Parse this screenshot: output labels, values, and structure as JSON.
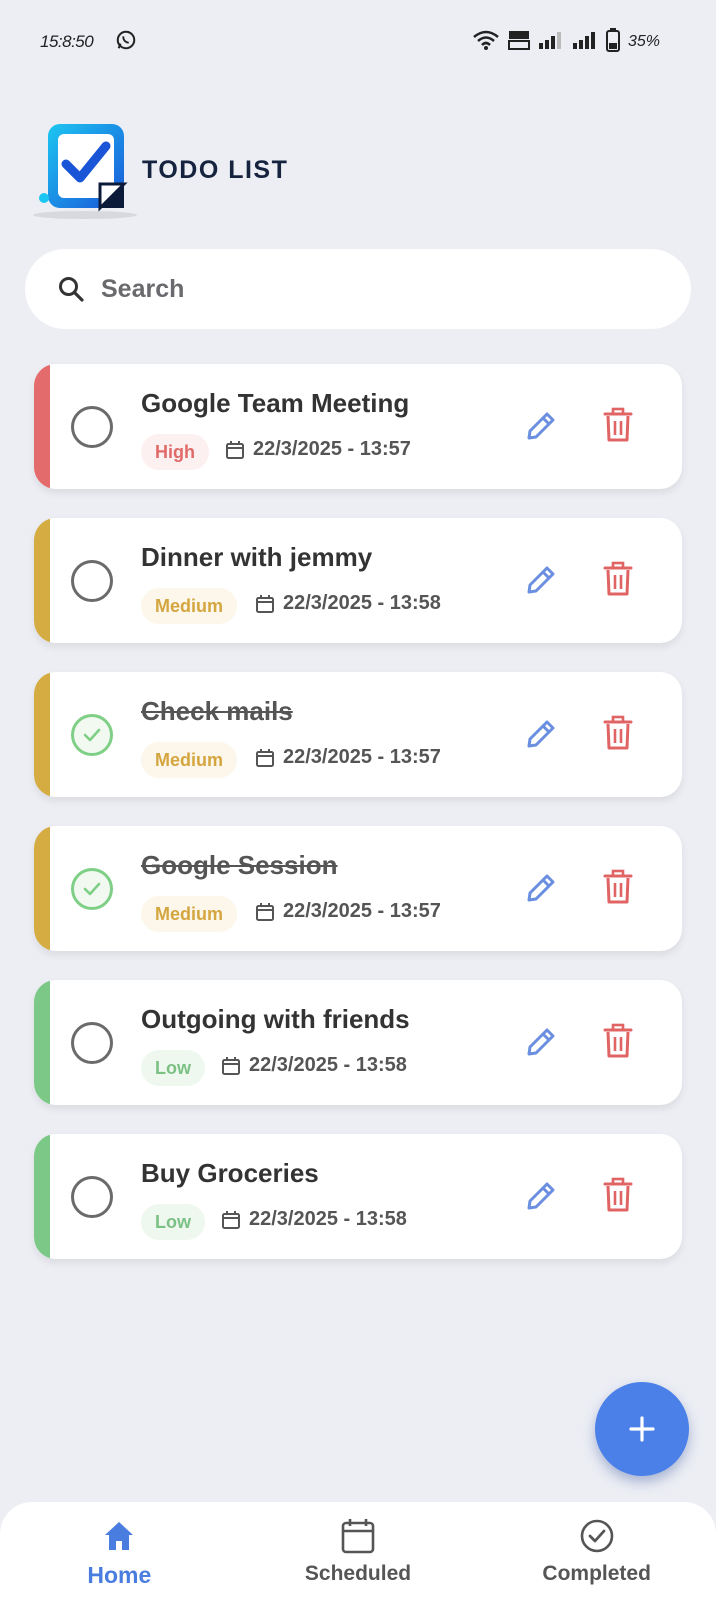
{
  "status_bar": {
    "time": "15:8:50",
    "battery": "35%"
  },
  "logo": {
    "text": "TODO LIST"
  },
  "search": {
    "placeholder": "Search"
  },
  "tasks": [
    {
      "title": "Google Team Meeting",
      "priority": "High",
      "date": "22/3/2025 - 13:57",
      "completed": false,
      "stripe_color": "#e46b6b"
    },
    {
      "title": "Dinner with jemmy",
      "priority": "Medium",
      "date": "22/3/2025 - 13:58",
      "completed": false,
      "stripe_color": "#d4ac42"
    },
    {
      "title": "Check mails",
      "priority": "Medium",
      "date": "22/3/2025 - 13:57",
      "completed": true,
      "stripe_color": "#d4ac42"
    },
    {
      "title": "Google Session",
      "priority": "Medium",
      "date": "22/3/2025 - 13:57",
      "completed": true,
      "stripe_color": "#d4ac42"
    },
    {
      "title": "Outgoing with friends",
      "priority": "Low",
      "date": "22/3/2025 - 13:58",
      "completed": false,
      "stripe_color": "#7cc886"
    },
    {
      "title": "Buy Groceries",
      "priority": "Low",
      "date": "22/3/2025 - 13:58",
      "completed": false,
      "stripe_color": "#7cc886"
    }
  ],
  "fab": {
    "icon": "plus-icon"
  },
  "bottom_nav": {
    "items": [
      {
        "label": "Home",
        "icon": "home-icon",
        "active": true
      },
      {
        "label": "Scheduled",
        "icon": "calendar-icon",
        "active": false
      },
      {
        "label": "Completed",
        "icon": "check-circle-icon",
        "active": false
      }
    ]
  },
  "colors": {
    "background": "#eceef4",
    "accent": "#4a80e8",
    "delete": "#e06464",
    "edit": "#6b8fe0",
    "done_check": "#7fcf86"
  }
}
